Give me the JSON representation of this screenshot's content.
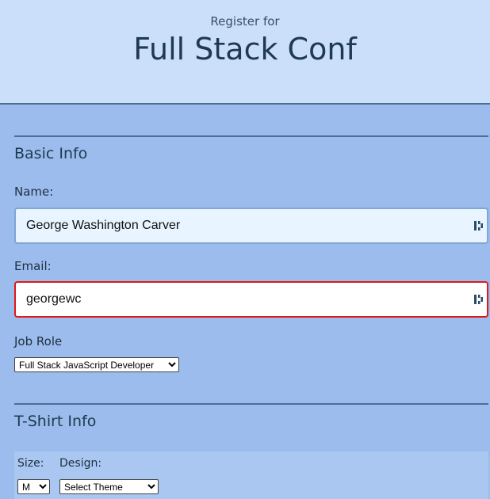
{
  "header": {
    "kicker": "Register for",
    "title": "Full Stack Conf"
  },
  "basic_info": {
    "section_title": "Basic Info",
    "name_label": "Name:",
    "name_value": "George Washington Carver",
    "email_label": "Email:",
    "email_value": "georgewc",
    "job_role_label": "Job Role",
    "job_role_selected": "Full Stack JavaScript Developer"
  },
  "tshirt_info": {
    "section_title": "T-Shirt Info",
    "size_label": "Size:",
    "size_selected": "M",
    "design_label": "Design:",
    "design_selected": "Select Theme"
  },
  "colors": {
    "header_bg": "#cbdffa",
    "page_bg": "#9bbcec",
    "invalid_border": "#e01818",
    "valid_border": "#7fa6d6"
  },
  "icons": {
    "field_autofill": "password-manager-icon"
  }
}
